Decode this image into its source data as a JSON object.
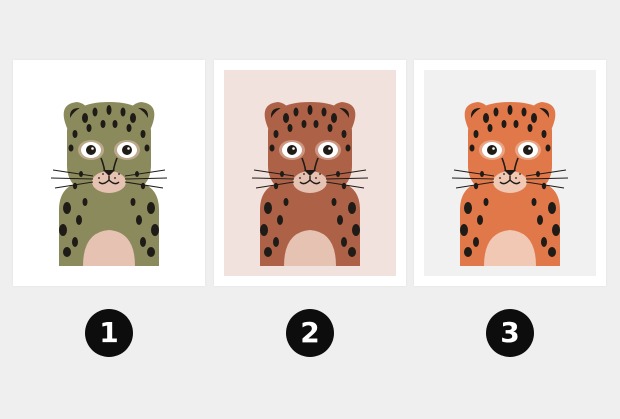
{
  "options": [
    {
      "number": "1",
      "mat_color": "#ffffff",
      "fur_color": "#8b8a5c",
      "muzzle_color": "#e6c2b3",
      "spot_color": "#1f1b17",
      "icon": "leopard-portrait-olive"
    },
    {
      "number": "2",
      "mat_color": "#f1e2de",
      "fur_color": "#ad6248",
      "muzzle_color": "#e6c2b3",
      "spot_color": "#1f1b17",
      "icon": "leopard-portrait-rust"
    },
    {
      "number": "3",
      "mat_color": "#f2f1f1",
      "fur_color": "#e0784a",
      "muzzle_color": "#f0c8b4",
      "spot_color": "#1f1b17",
      "icon": "leopard-portrait-orange"
    }
  ]
}
